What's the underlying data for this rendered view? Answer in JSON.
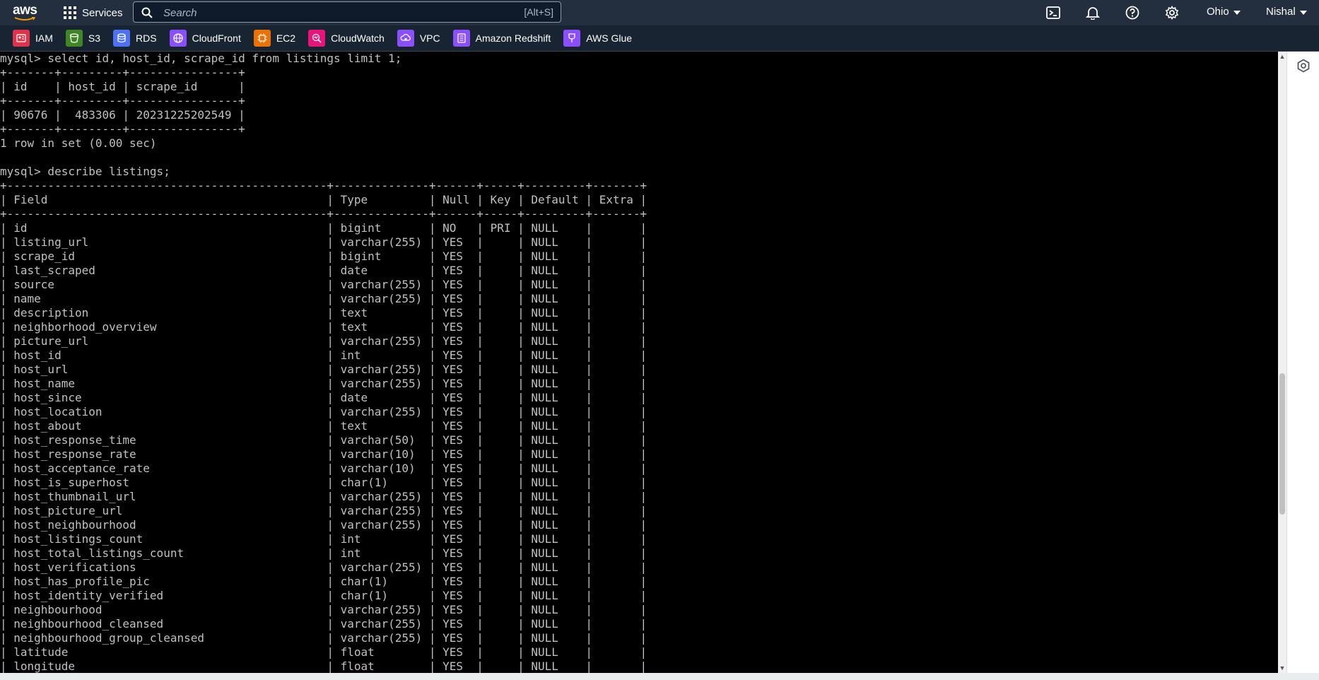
{
  "header": {
    "logo_text": "aws",
    "services_label": "Services",
    "search_placeholder": "Search",
    "search_shortcut": "[Alt+S]",
    "region_label": "Ohio",
    "user_label": "Nishal",
    "icons": [
      "cloudshell-icon",
      "notifications-bell-icon",
      "help-icon",
      "settings-gear-icon"
    ]
  },
  "favorites": [
    {
      "label": "IAM",
      "color": "#dd344c",
      "icon": "iam-icon"
    },
    {
      "label": "S3",
      "color": "#3f8624",
      "icon": "s3-bucket-icon"
    },
    {
      "label": "RDS",
      "color": "#4d72f3",
      "icon": "rds-database-icon"
    },
    {
      "label": "CloudFront",
      "color": "#8c4fff",
      "icon": "cloudfront-icon"
    },
    {
      "label": "EC2",
      "color": "#ed7100",
      "icon": "ec2-icon"
    },
    {
      "label": "CloudWatch",
      "color": "#e7157b",
      "icon": "cloudwatch-icon"
    },
    {
      "label": "VPC",
      "color": "#8c4fff",
      "icon": "vpc-icon"
    },
    {
      "label": "Amazon Redshift",
      "color": "#8c4fff",
      "icon": "redshift-icon"
    },
    {
      "label": "AWS Glue",
      "color": "#8c4fff",
      "icon": "glue-icon"
    }
  ],
  "terminal": {
    "lines": [
      "mysql> select id, host_id, scrape_id from listings limit 1;",
      "+-------+---------+----------------+",
      "| id    | host_id | scrape_id      |",
      "+-------+---------+----------------+",
      "| 90676 |  483306 | 20231225202549 |",
      "+-------+---------+----------------+",
      "1 row in set (0.00 sec)",
      "",
      "mysql> describe listings;",
      "+-----------------------------------------------+--------------+------+-----+---------+-------+",
      "| Field                                         | Type         | Null | Key | Default | Extra |",
      "+-----------------------------------------------+--------------+------+-----+---------+-------+",
      "| id                                            | bigint       | NO   | PRI | NULL    |       |",
      "| listing_url                                   | varchar(255) | YES  |     | NULL    |       |",
      "| scrape_id                                     | bigint       | YES  |     | NULL    |       |",
      "| last_scraped                                  | date         | YES  |     | NULL    |       |",
      "| source                                        | varchar(255) | YES  |     | NULL    |       |",
      "| name                                          | varchar(255) | YES  |     | NULL    |       |",
      "| description                                   | text         | YES  |     | NULL    |       |",
      "| neighborhood_overview                         | text         | YES  |     | NULL    |       |",
      "| picture_url                                   | varchar(255) | YES  |     | NULL    |       |",
      "| host_id                                       | int          | YES  |     | NULL    |       |",
      "| host_url                                      | varchar(255) | YES  |     | NULL    |       |",
      "| host_name                                     | varchar(255) | YES  |     | NULL    |       |",
      "| host_since                                    | date         | YES  |     | NULL    |       |",
      "| host_location                                 | varchar(255) | YES  |     | NULL    |       |",
      "| host_about                                    | text         | YES  |     | NULL    |       |",
      "| host_response_time                            | varchar(50)  | YES  |     | NULL    |       |",
      "| host_response_rate                            | varchar(10)  | YES  |     | NULL    |       |",
      "| host_acceptance_rate                          | varchar(10)  | YES  |     | NULL    |       |",
      "| host_is_superhost                             | char(1)      | YES  |     | NULL    |       |",
      "| host_thumbnail_url                            | varchar(255) | YES  |     | NULL    |       |",
      "| host_picture_url                              | varchar(255) | YES  |     | NULL    |       |",
      "| host_neighbourhood                            | varchar(255) | YES  |     | NULL    |       |",
      "| host_listings_count                           | int          | YES  |     | NULL    |       |",
      "| host_total_listings_count                     | int          | YES  |     | NULL    |       |",
      "| host_verifications                            | varchar(255) | YES  |     | NULL    |       |",
      "| host_has_profile_pic                          | char(1)      | YES  |     | NULL    |       |",
      "| host_identity_verified                        | char(1)      | YES  |     | NULL    |       |",
      "| neighbourhood                                 | varchar(255) | YES  |     | NULL    |       |",
      "| neighbourhood_cleansed                        | varchar(255) | YES  |     | NULL    |       |",
      "| neighbourhood_group_cleansed                  | varchar(255) | YES  |     | NULL    |       |",
      "| latitude                                      | float        | YES  |     | NULL    |       |",
      "| longitude                                     | float        | YES  |     | NULL    |       |"
    ]
  }
}
